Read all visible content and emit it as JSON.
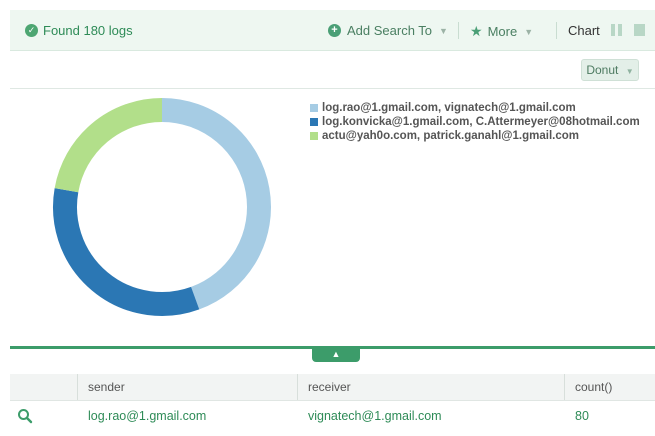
{
  "topbar": {
    "found_label": "Found 180 logs",
    "add_search_label": "Add Search To",
    "more_label": "More",
    "chart_label": "Chart"
  },
  "chart_type_button": "Donut",
  "chart_data": {
    "type": "pie",
    "variant": "donut",
    "series": [
      {
        "name": "log.rao@1.gmail.com, vignatech@1.gmail.com",
        "value": 80,
        "color": "#a6cce4"
      },
      {
        "name": "log.konvicka@1.gmail.com, C.Attermeyer@08hotmail.com",
        "value": 60,
        "color": "#2b77b4"
      },
      {
        "name": "actu@yah0o.com, patrick.ganahl@1.gmail.com",
        "value": 40,
        "color": "#b2df8a"
      }
    ],
    "legend_position": "top-right"
  },
  "table": {
    "headers": [
      "sender",
      "receiver",
      "count()"
    ],
    "rows": [
      {
        "sender": "log.rao@1.gmail.com",
        "receiver": "vignatech@1.gmail.com",
        "count": "80"
      }
    ]
  },
  "colors": {
    "accent": "#3c9c6a",
    "link": "#2e8b57"
  }
}
